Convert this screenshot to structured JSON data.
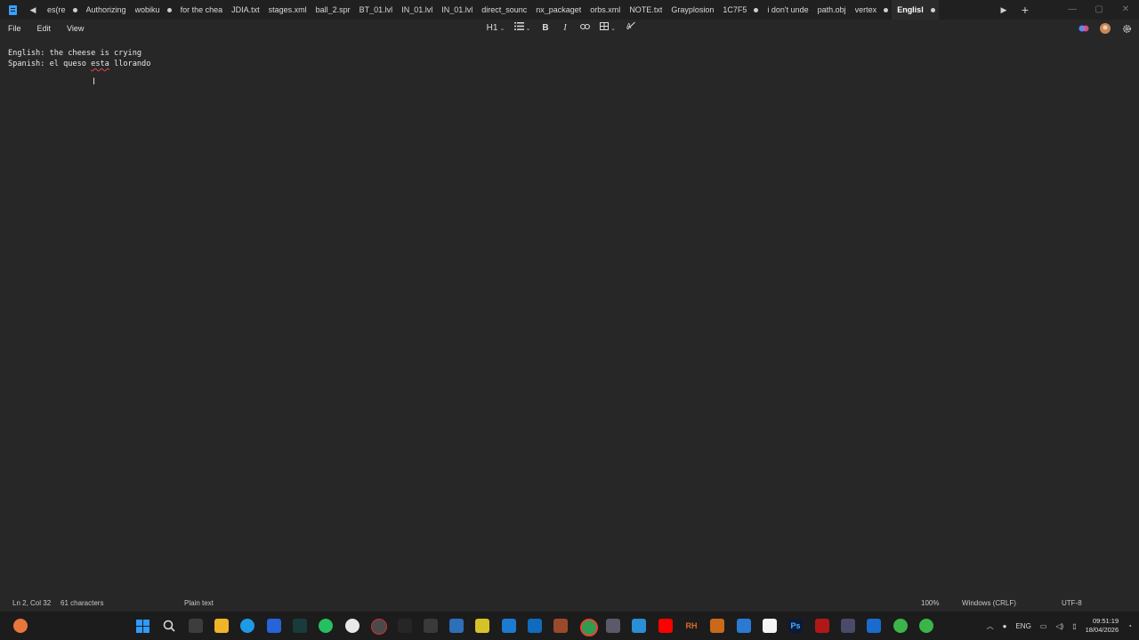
{
  "window": {
    "tabs": [
      {
        "label": "‎es(re",
        "dot": true
      },
      {
        "label": "Authorizing",
        "dot": false
      },
      {
        "label": "wobiku",
        "dot": true
      },
      {
        "label": "for the chea",
        "dot": false
      },
      {
        "label": "JDIA.txt",
        "dot": false
      },
      {
        "label": "stages.xml",
        "dot": false
      },
      {
        "label": "ball_2.spr",
        "dot": false
      },
      {
        "label": "BT_01.lvl",
        "dot": false
      },
      {
        "label": "IN_01.lvl",
        "dot": false
      },
      {
        "label": "IN_01.lvl",
        "dot": false
      },
      {
        "label": "direct_sounc",
        "dot": false
      },
      {
        "label": "nx_packaget",
        "dot": false
      },
      {
        "label": "orbs.xml",
        "dot": false
      },
      {
        "label": "NOTE.txt",
        "dot": false
      },
      {
        "label": "Grayplosion",
        "dot": false
      },
      {
        "label": "1C7F5",
        "dot": true
      },
      {
        "label": "i don't unde",
        "dot": false
      },
      {
        "label": "path.obj",
        "dot": false
      },
      {
        "label": "vertex",
        "dot": true
      },
      {
        "label": "Englisl",
        "dot": true,
        "active": true
      }
    ],
    "new_tab": "+",
    "scroll_left": "◀",
    "scroll_right": "▶",
    "controls": {
      "minimize": "—",
      "maximize": "▢",
      "close": "✕"
    }
  },
  "menu": {
    "file": "File",
    "edit": "Edit",
    "view": "View"
  },
  "toolbar": {
    "heading": "H1",
    "list_icon": "list-icon",
    "bold": "B",
    "italic": "I",
    "link_icon": "link-icon",
    "table_icon": "table-icon",
    "clear_format_icon": "clear-formatting-icon"
  },
  "document": {
    "line1": "English: the cheese is crying",
    "line2_prefix": "Spanish: el queso ",
    "line2_misspelled": "esta",
    "line2_suffix": " llorando"
  },
  "status": {
    "position": "Ln 2, Col 32",
    "characters": "61 characters",
    "format": "Plain text",
    "zoom": "100%",
    "line_ending": "Windows (CRLF)",
    "encoding": "UTF-8"
  },
  "tray": {
    "language": "ENG",
    "time": "09:51:19",
    "date": "18/04/2026"
  },
  "colors": {
    "accent": "#3aa0ff",
    "misspell": "#e04848",
    "background": "#272727"
  }
}
